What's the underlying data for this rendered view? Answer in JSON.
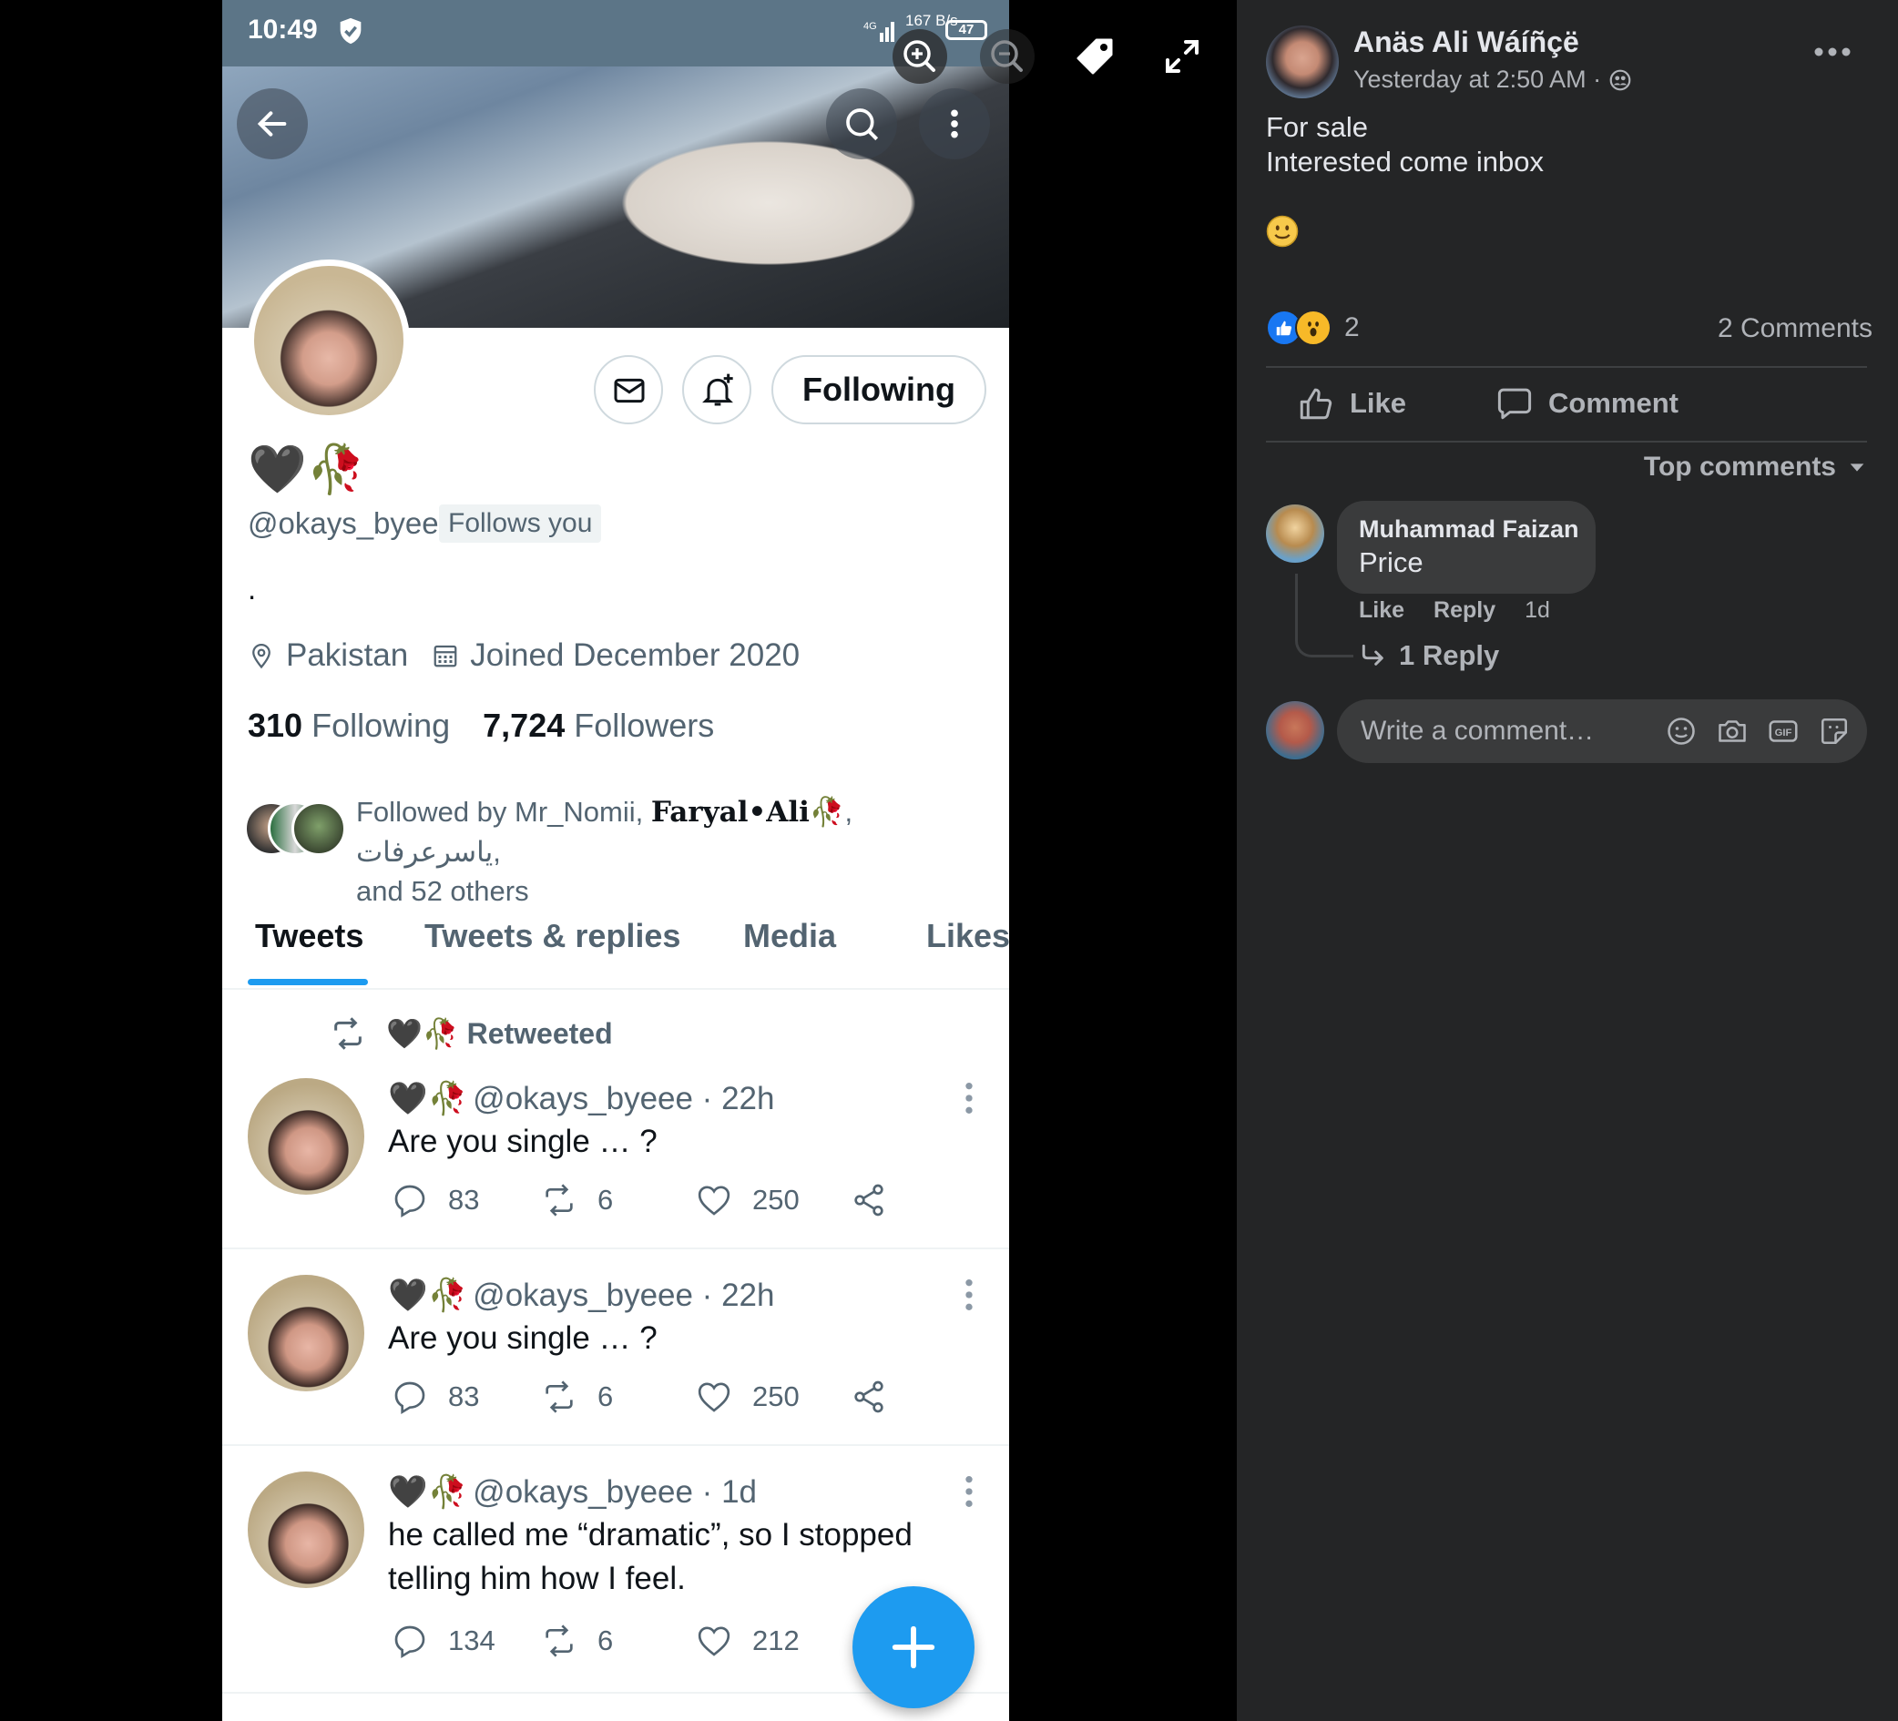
{
  "viewer": {
    "icons": [
      "zoom-in-icon",
      "zoom-out-icon",
      "tag-icon",
      "fullscreen-icon"
    ]
  },
  "phone": {
    "status": {
      "time": "10:49",
      "network_speed": "167\nB/s",
      "network_type": "4G",
      "battery": "47"
    },
    "profile": {
      "display_name": "🖤🥀",
      "handle": "@okays_byeee",
      "follows_you": "Follows you",
      "bio": ".",
      "location": "Pakistan",
      "joined": "Joined December 2020",
      "following_count": "310",
      "following_label": "Following",
      "followers_count": "7,724",
      "followers_label": "Followers",
      "followed_by_prefix": "Followed by Mr_Nomii, ",
      "followed_by_bold": "Faryal•Ali",
      "followed_by_rest": "🥀, یاسرعرفات,",
      "followed_by_line2": "and 52 others",
      "following_button": "Following"
    },
    "tabs": [
      "Tweets",
      "Tweets & replies",
      "Media",
      "Likes"
    ],
    "retweeted_label": "🖤🥀 Retweeted",
    "tweets": [
      {
        "emoji": "🖤🥀",
        "meta": "@okays_byeee · 22h",
        "text": "Are you single … ?",
        "replies": "83",
        "retweets": "6",
        "likes": "250"
      },
      {
        "emoji": "🖤🥀",
        "meta": "@okays_byeee · 22h",
        "text": "Are you single … ?",
        "replies": "83",
        "retweets": "6",
        "likes": "250"
      },
      {
        "emoji": "🖤🥀",
        "meta": "@okays_byeee · 1d",
        "text": "he called me “dramatic”, so I stopped telling him how I feel.",
        "replies": "134",
        "retweets": "6",
        "likes": "212"
      }
    ]
  },
  "post": {
    "author": "Anäs Ali Wáíñçë",
    "time": "Yesterday at 2:50 AM ·",
    "body_line1": "For sale",
    "body_line2": "Interested come inbox",
    "reaction_count": "2",
    "comments_count": "2 Comments",
    "like_label": "Like",
    "comment_label": "Comment",
    "sort_label": "Top comments",
    "comment": {
      "author": "Muhammad Faizan",
      "text": "Price",
      "like": "Like",
      "reply": "Reply",
      "age": "1d",
      "replies": "1 Reply"
    },
    "input_placeholder": "Write a comment…"
  },
  "colors": {
    "twitter_blue": "#1d9bf0",
    "fb_panel_bg": "#242526",
    "fb_bubble_bg": "#3a3b3c",
    "like_blue": "#1877f2",
    "wow_yellow": "#f7b928"
  }
}
